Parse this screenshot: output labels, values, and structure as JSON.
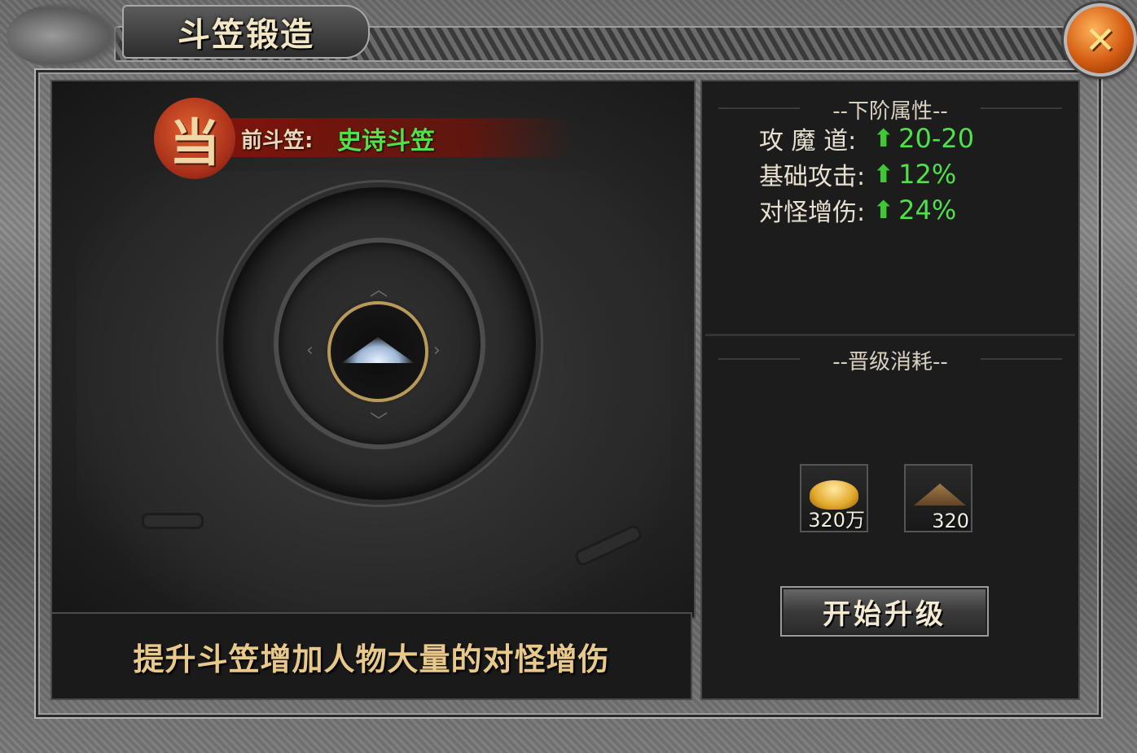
{
  "window": {
    "title": "斗笠锻造",
    "close_icon": "close-x-icon"
  },
  "current": {
    "badge": "当",
    "label": "前斗笠:",
    "value": "史诗斗笠",
    "value_color": "#4fe04a"
  },
  "description": "提升斗笠增加人物大量的对怪增伤",
  "next_attributes": {
    "header": "--下阶属性--",
    "rows": [
      {
        "label": "攻 魔 道:",
        "value": "20-20"
      },
      {
        "label": "基础攻击:",
        "value": "12%"
      },
      {
        "label": "对怪增伤:",
        "value": "24%"
      }
    ]
  },
  "upgrade_cost": {
    "header": "--晋级消耗--",
    "items": [
      {
        "icon": "gold-ingot-icon",
        "quantity": "320万"
      },
      {
        "icon": "bamboo-hat-icon",
        "quantity": "320"
      }
    ]
  },
  "button": {
    "upgrade_label": "开始升级"
  }
}
